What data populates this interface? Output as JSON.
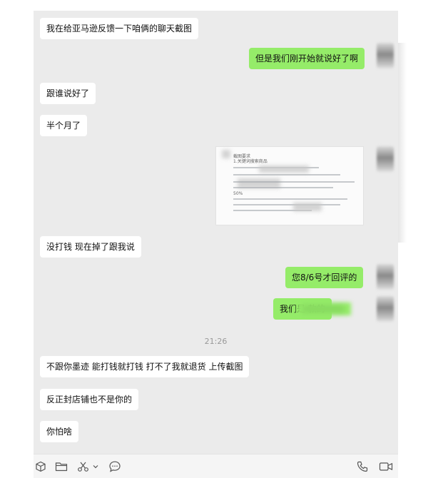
{
  "messages": [
    {
      "side": "left",
      "text": "我在给亚马逊反馈一下咱俩的聊天截图"
    },
    {
      "side": "right",
      "text": "但是我们刚开始就说好了啊"
    },
    {
      "side": "left",
      "text": "跟谁说好了"
    },
    {
      "side": "left",
      "text": "半个月了"
    },
    {
      "side": "left",
      "text": "没打钱 现在掉了跟我说"
    },
    {
      "side": "right",
      "text": "您8/6号才回评的"
    },
    {
      "side": "right",
      "text": "我们是                 款的"
    },
    {
      "side": "left",
      "text": "不跟你墨迹 能打钱就打钱 打不了我就退货 上传截图"
    },
    {
      "side": "left",
      "text": "反正封店铺也不是你的"
    },
    {
      "side": "left",
      "text": "你怕啥"
    }
  ],
  "timestamp": "21:26",
  "image_message": {
    "lines": [
      "截图要求",
      "1.关键词搜索商品",
      "2.",
      "50%",
      "评价后。"
    ]
  },
  "toolbar": {
    "left_icons": [
      "box-icon",
      "folder-icon",
      "scissors-icon",
      "chevron-down-icon",
      "chat-bubble-icon"
    ],
    "right_icons": [
      "phone-icon",
      "video-icon"
    ]
  }
}
